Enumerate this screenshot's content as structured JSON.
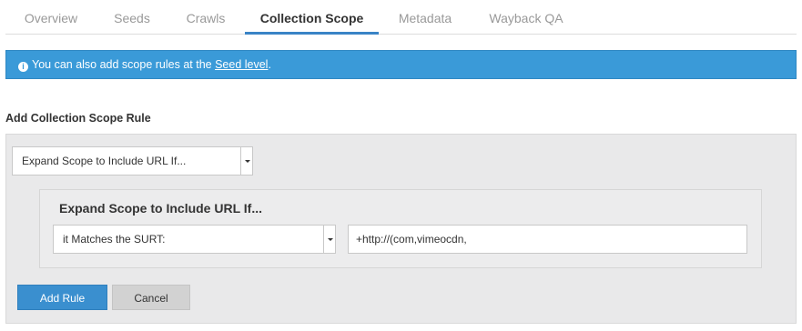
{
  "tabs": [
    {
      "label": "Overview",
      "active": false
    },
    {
      "label": "Seeds",
      "active": false
    },
    {
      "label": "Crawls",
      "active": false
    },
    {
      "label": "Collection Scope",
      "active": true
    },
    {
      "label": "Metadata",
      "active": false
    },
    {
      "label": "Wayback QA",
      "active": false
    }
  ],
  "alert": {
    "icon": "info-circle-icon",
    "text_before": "You can also add scope rules at the ",
    "link_text": "Seed level",
    "text_after": ".",
    "color": "#3a9ad8"
  },
  "section": {
    "title": "Add Collection Scope Rule"
  },
  "rule_type_select": {
    "value": "Expand Scope to Include URL If..."
  },
  "rule": {
    "title": "Expand Scope to Include URL If...",
    "condition_select": "it Matches the SURT:",
    "surt_value": "+http://(com,vimeocdn,"
  },
  "buttons": {
    "add_rule": "Add Rule",
    "cancel": "Cancel"
  },
  "colors": {
    "accent": "#3a8fcf",
    "panel_bg": "#e9e9ea"
  }
}
